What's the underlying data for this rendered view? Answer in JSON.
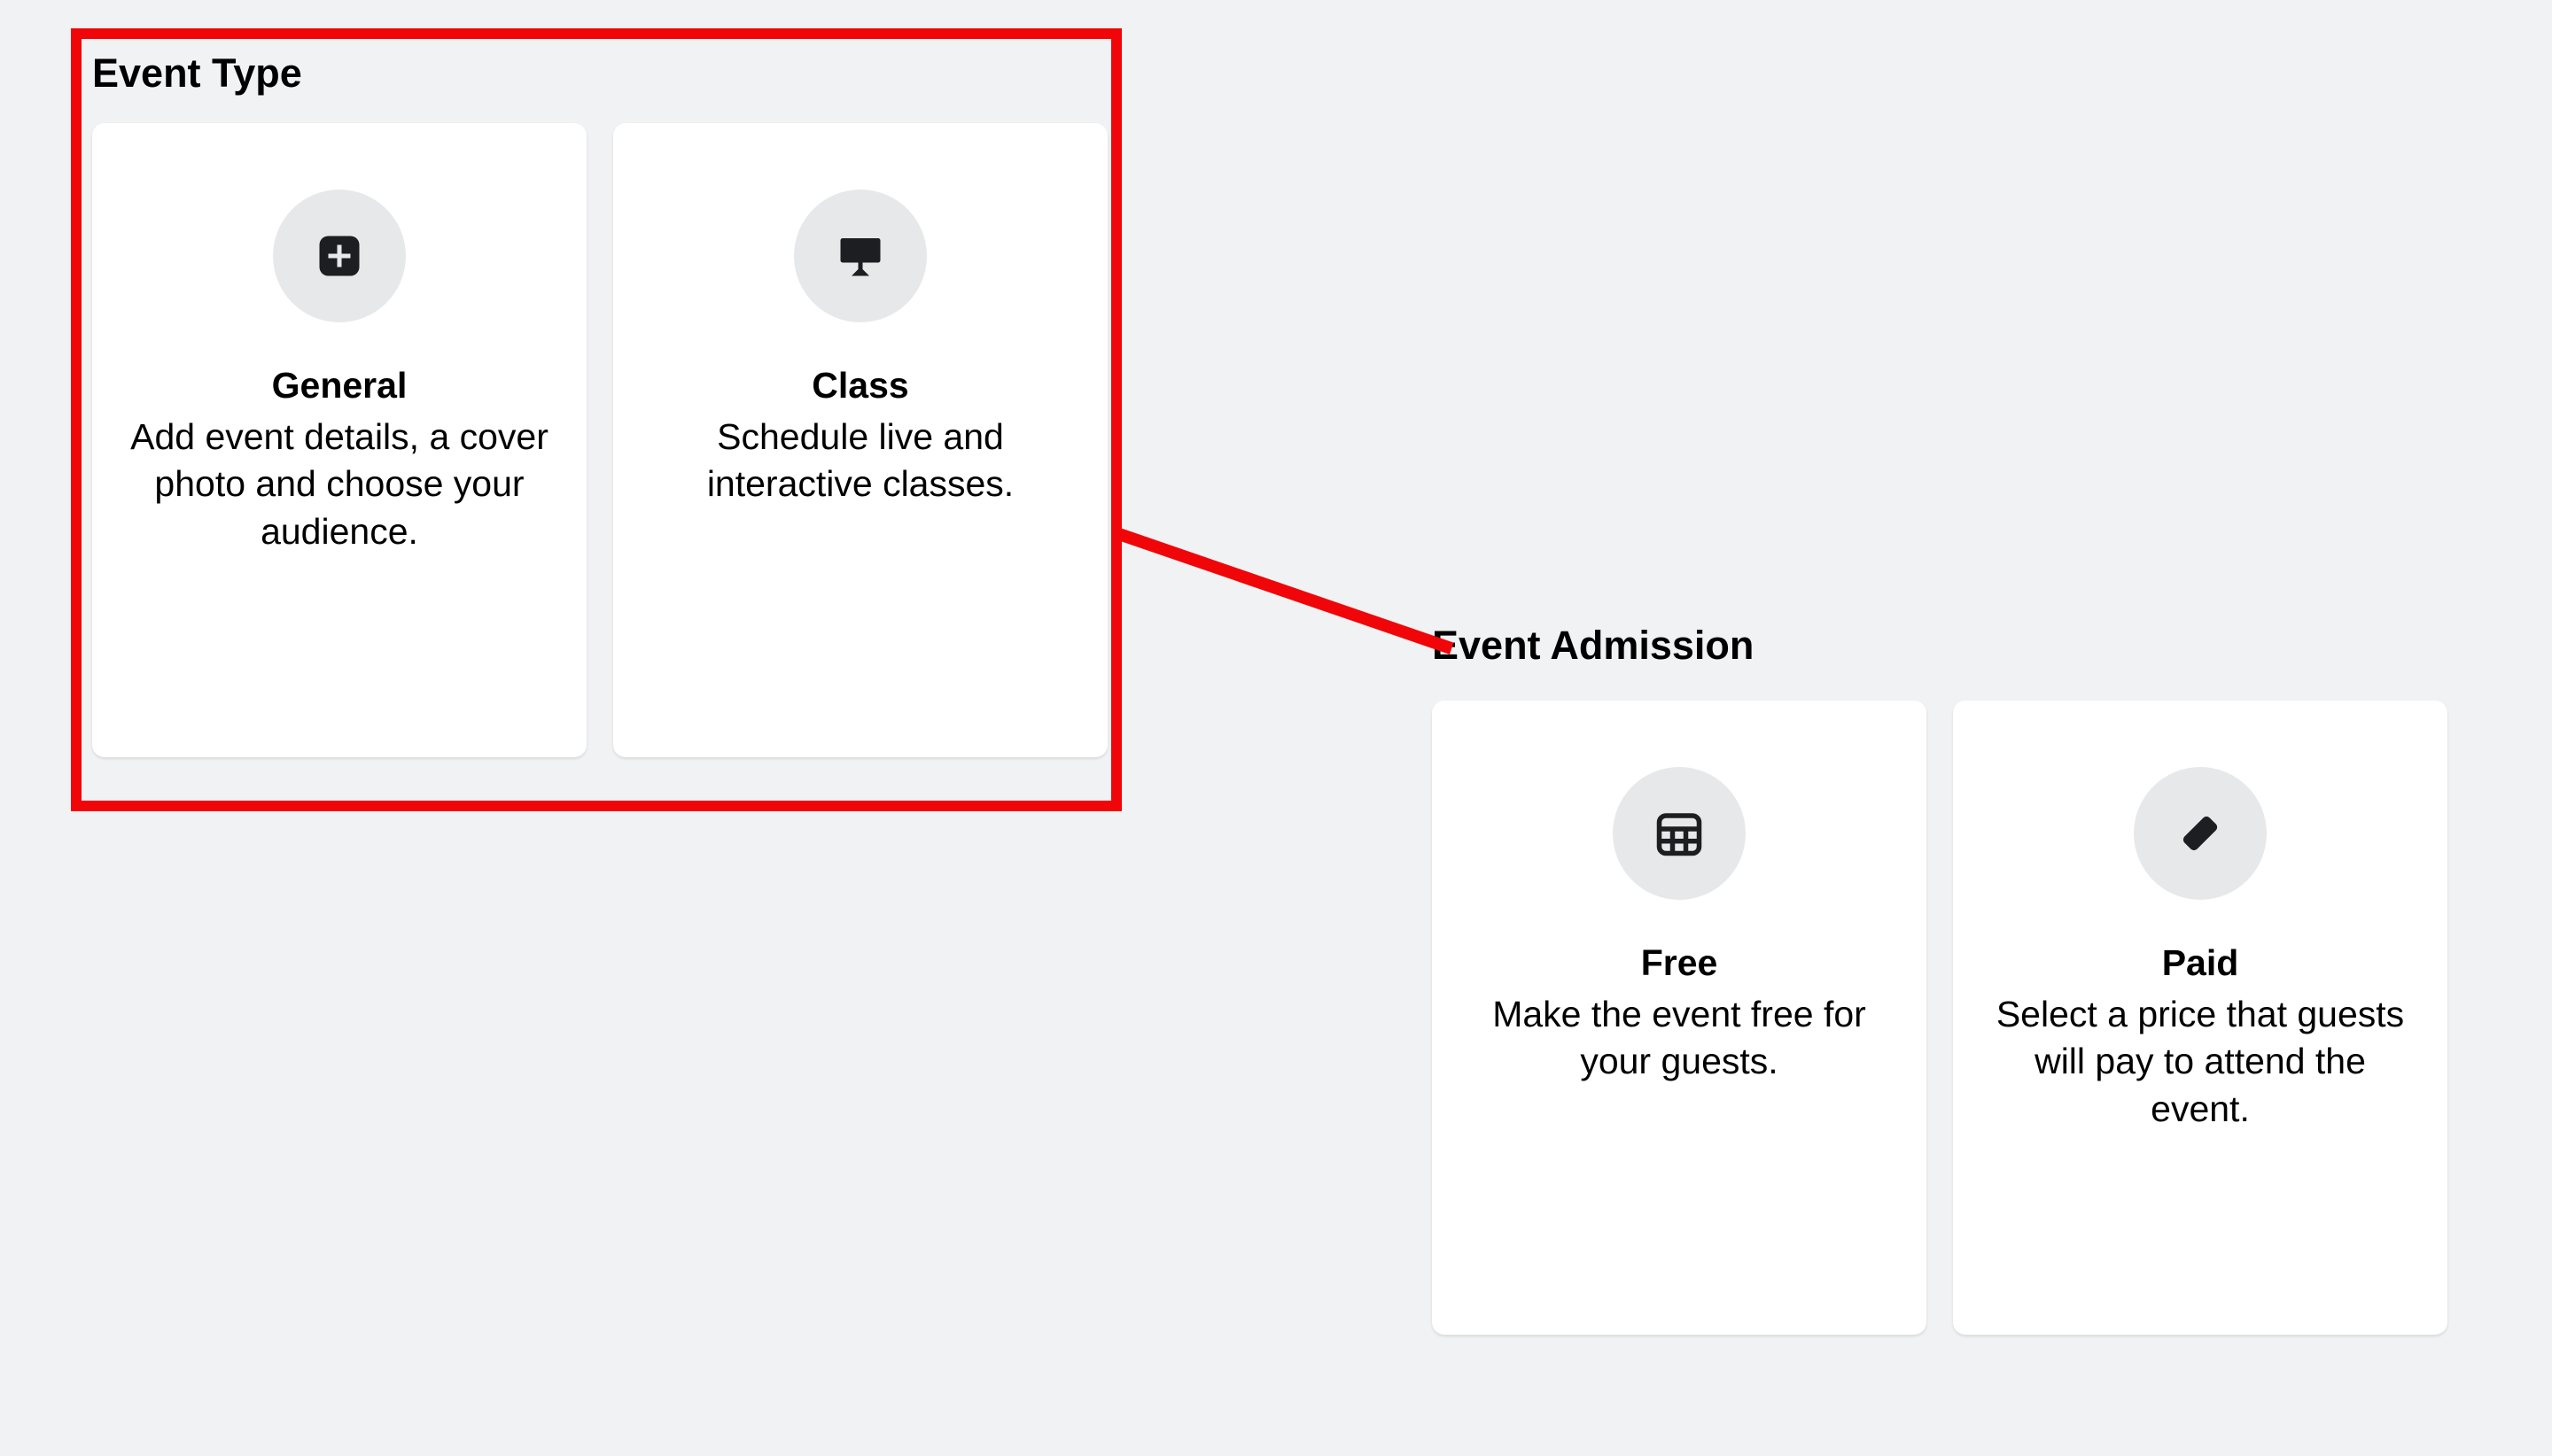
{
  "event_type": {
    "heading": "Event Type",
    "cards": [
      {
        "title": "General",
        "desc": "Add event details, a cover photo and choose your audience."
      },
      {
        "title": "Class",
        "desc": "Schedule live and interactive classes."
      }
    ]
  },
  "event_admission": {
    "heading": "Event Admission",
    "cards": [
      {
        "title": "Free",
        "desc": "Make the event free for your guests."
      },
      {
        "title": "Paid",
        "desc": "Select a price that guests will pay to attend the event."
      }
    ]
  },
  "annotation": {
    "highlight_color": "#f00509"
  }
}
